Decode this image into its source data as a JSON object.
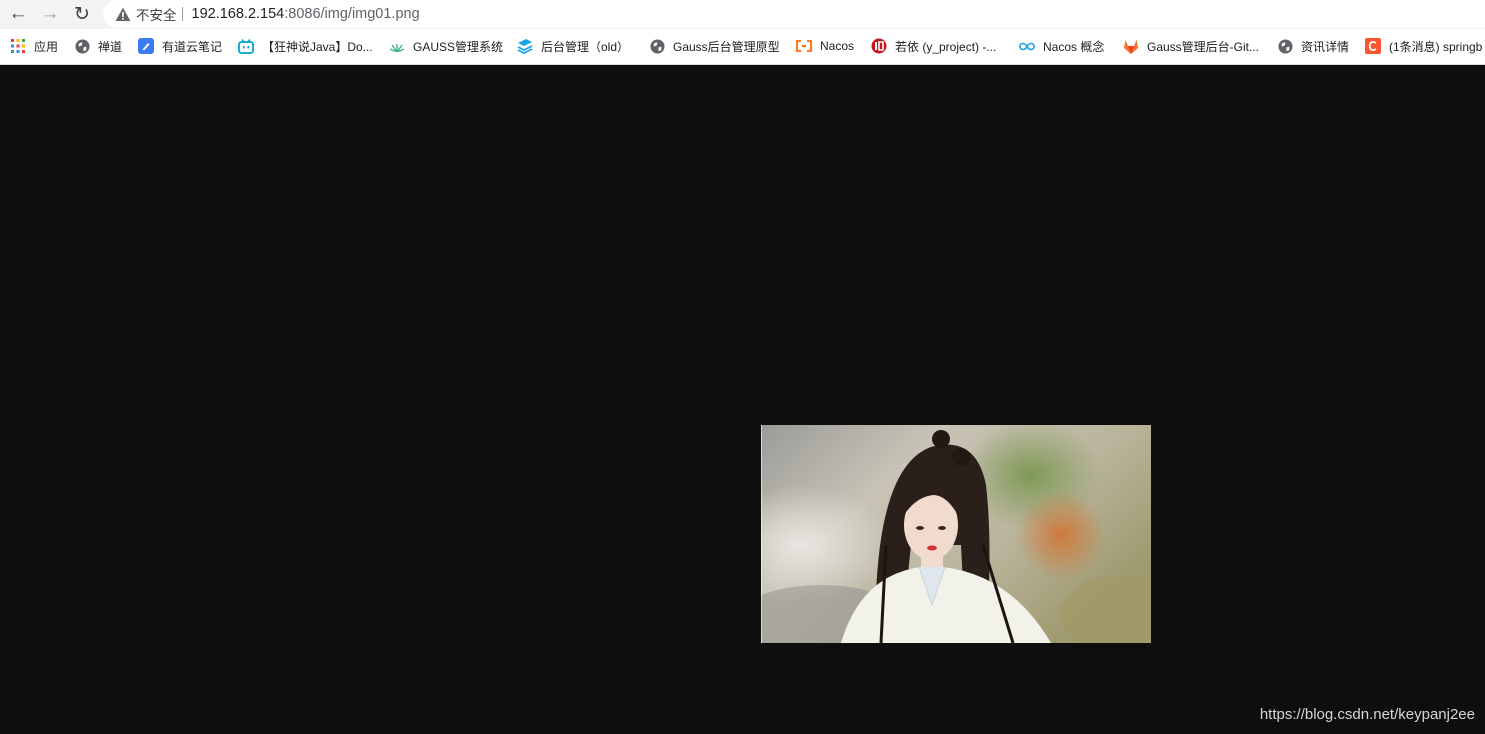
{
  "browser": {
    "nav": {
      "back": "←",
      "forward": "→",
      "reload": "↻"
    },
    "omnibox": {
      "security_label": "不安全",
      "url_host": "192.168.2.154",
      "url_rest": ":8086/img/img01.png"
    },
    "bookmarks": [
      {
        "label": "应用",
        "icon": "apps-grid-icon"
      },
      {
        "label": "禅道",
        "icon": "globe-icon"
      },
      {
        "label": "有道云笔记",
        "icon": "youdao-note-icon"
      },
      {
        "label": "【狂神说Java】Do...",
        "icon": "bilibili-icon"
      },
      {
        "label": "GAUSS管理系统",
        "icon": "gauss-leaf-icon"
      },
      {
        "label": "后台管理（old）",
        "icon": "layers-icon"
      },
      {
        "label": "Gauss后台管理原型",
        "icon": "globe-icon"
      },
      {
        "label": "Nacos",
        "icon": "nacos-icon"
      },
      {
        "label": "若依 (y_project) -...",
        "icon": "ruoyi-icon"
      },
      {
        "label": "Nacos 概念",
        "icon": "infinity-icon"
      },
      {
        "label": "Gauss管理后台-Git...",
        "icon": "gitlab-icon"
      },
      {
        "label": "资讯详情",
        "icon": "globe-icon"
      },
      {
        "label": "(1条消息) springb",
        "icon": "csdn-icon"
      }
    ]
  },
  "page": {
    "image_alt": "img01.png",
    "watermark": "https://blog.csdn.net/keypanj2ee"
  },
  "colors": {
    "page_background": "#0e0e0e",
    "toolbar_background": "#f1f3f4",
    "warning_icon": "#5f6368"
  }
}
